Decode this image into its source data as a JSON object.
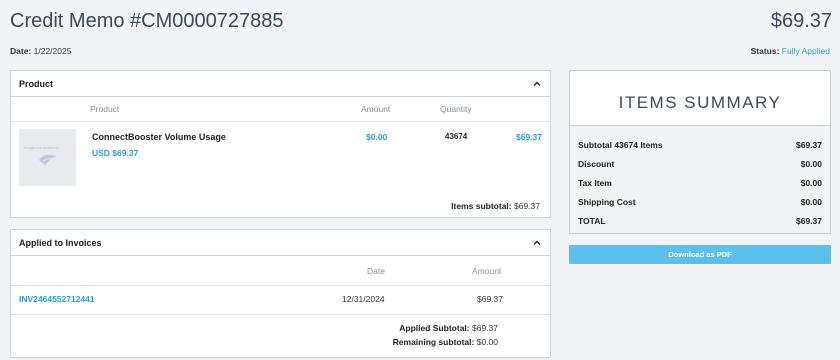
{
  "header": {
    "title": "Credit Memo #CM0000727885",
    "total": "$69.37",
    "date_label": "Date:",
    "date_value": "1/22/2025",
    "status_label": "Status:",
    "status_value": "Fully Applied"
  },
  "product_card": {
    "title": "Product",
    "columns": [
      "Product",
      "Amount",
      "Quantity"
    ],
    "item": {
      "image_caption": "Image not available",
      "name": "ConnectBooster Volume Usage",
      "price": "USD $69.37",
      "amount": "$0.00",
      "quantity": "43674",
      "total": "$69.37"
    },
    "subtotal_label": "Items subtotal:",
    "subtotal_value": "$69.37"
  },
  "invoices_card": {
    "title": "Applied to Invoices",
    "columns": [
      "Date",
      "Amount"
    ],
    "rows": [
      {
        "invoice": "INV2464552712441",
        "date": "12/31/2024",
        "amount": "$69.37"
      }
    ],
    "applied_label": "Applied Subtotal:",
    "applied_value": "$69.37",
    "remaining_label": "Remaining subtotal:",
    "remaining_value": "$0.00"
  },
  "summary": {
    "title": "ITEMS SUMMARY",
    "rows": [
      {
        "label": "Subtotal 43674 Items",
        "value": "$69.37"
      },
      {
        "label": "Discount",
        "value": "$0.00"
      },
      {
        "label": "Tax Item",
        "value": "$0.00"
      },
      {
        "label": "Shipping Cost",
        "value": "$0.00"
      },
      {
        "label": "TOTAL",
        "value": "$69.37"
      }
    ]
  },
  "actions": {
    "download_label": "Download as PDF"
  },
  "colors": {
    "accent": "#2a9fd8",
    "button": "#5bc0eb",
    "background": "#f2f3f4"
  },
  "icons": [
    "chevron-up-icon",
    "product-placeholder-icon"
  ]
}
